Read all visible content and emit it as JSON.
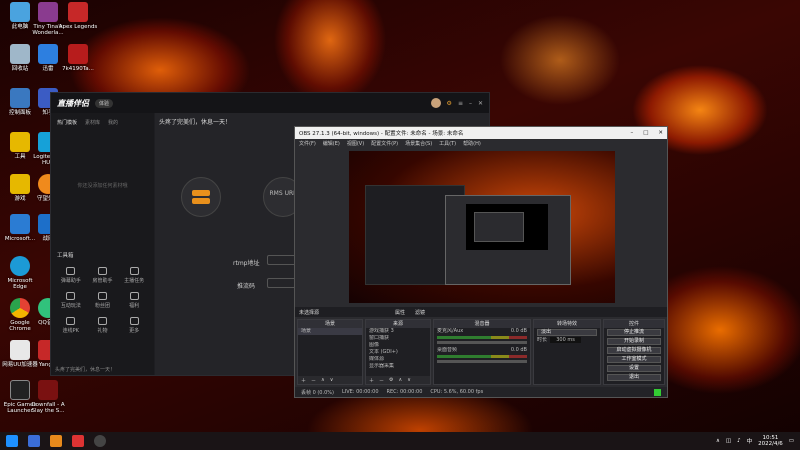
{
  "desktop": {
    "icons": [
      {
        "label": "此电脑",
        "color": "#4aa3df"
      },
      {
        "label": "回收站",
        "color": "#9fb7c9"
      },
      {
        "label": "控制面板",
        "color": "#3a78c0"
      },
      {
        "label": "工具",
        "color": "#e6b800"
      },
      {
        "label": "游戏",
        "color": "#e6b800"
      },
      {
        "label": "Microsoft...",
        "color": "#2b7cd3"
      },
      {
        "label": "Microsoft Edge",
        "color": "#1c9ad6"
      },
      {
        "label": "Google Chrome",
        "color": "#e34133"
      },
      {
        "label": "网易UU加速器",
        "color": "#e8e8e8"
      },
      {
        "label": "Epic Games Launcher",
        "color": "#222222"
      },
      {
        "label": "Tiny Tina's Wonderla...",
        "color": "#8a3b8f"
      },
      {
        "label": "迅雷",
        "color": "#2d7fe0"
      },
      {
        "label": "知乎",
        "color": "#3b5cc4"
      },
      {
        "label": "Logitech G HUB",
        "color": "#16a1d8"
      },
      {
        "label": "守望先锋",
        "color": "#f08a1c"
      },
      {
        "label": "战网",
        "color": "#1d6fc9"
      },
      {
        "label": "QQ音乐",
        "color": "#31c27c"
      },
      {
        "label": "Yang...",
        "color": "#c62828"
      },
      {
        "label": "Downfall - A Slay the S...",
        "color": "#7a1111"
      },
      {
        "label": "Apex Legends",
        "color": "#c62828"
      },
      {
        "label": "7k4190Ta...",
        "color": "#b71c1c"
      }
    ]
  },
  "zhibo": {
    "logo": "直播伴侣",
    "pill": "体验",
    "headline": "头疼了完美们，休息一天！",
    "tabs": [
      "热门模板",
      "素材库",
      "我的"
    ],
    "tool_title": "工具箱",
    "tools": [
      "弹幕助手",
      "房管助手",
      "主播任务",
      "互动玩法",
      "粉丝团",
      "福利",
      "连线PK",
      "礼物",
      "更多"
    ],
    "rtmp_label": "rtmp地址",
    "key_label": "推流码",
    "rms_label": "RMS URL",
    "empty_text": "你还没添加任何素材哦",
    "footer_tip": "头疼了完美们，休息一天！"
  },
  "obs": {
    "title": "OBS 27.1.3 (64-bit, windows) - 配置文件: 未命名 - 场景: 未命名",
    "menu": [
      "文件(F)",
      "编辑(E)",
      "视图(V)",
      "配置文件(P)",
      "场景集合(S)",
      "工具(T)",
      "帮助(H)"
    ],
    "scene_bar": {
      "label": "未选择源",
      "props": "属性",
      "filters": "滤镜"
    },
    "scenes_header": "场景",
    "scenes": [
      "场景"
    ],
    "sources_header": "来源",
    "sources": [
      "游戏捕获 3",
      "窗口捕获",
      "图像",
      "文本 (GDI+)",
      "媒体源",
      "显示器采集"
    ],
    "mixer_header": "混音器",
    "mixer": [
      {
        "name": "麦克风/Aux",
        "db": "0.0 dB"
      },
      {
        "name": "桌面音频",
        "db": "0.0 dB"
      }
    ],
    "transition_header": "转场特效",
    "transition": "淡出",
    "duration_label": "时长",
    "duration": "300 ms",
    "controls_header": "控件",
    "controls": [
      "停止推流",
      "开始录制",
      "启动虚拟摄像机",
      "工作室模式",
      "设置",
      "退出"
    ],
    "status": {
      "dropped": "丢帧 0 (0.0%)",
      "live": "LIVE: 00:00:00",
      "rec": "REC: 00:00:00",
      "cpu": "CPU: 5.6%, 60.00 fps"
    }
  },
  "taskbar": {
    "time": "10:51",
    "date": "2022/4/6",
    "lang": "中"
  }
}
